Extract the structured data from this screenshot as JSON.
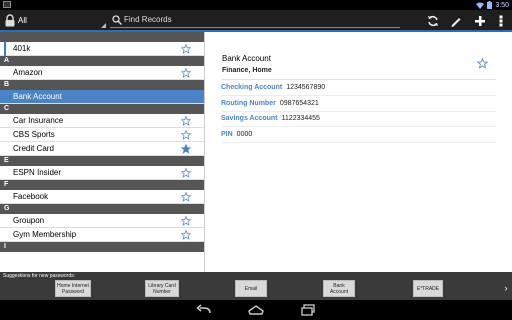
{
  "status": {
    "time": "3:50"
  },
  "actionbar": {
    "category": "All",
    "search_placeholder": "Find Records"
  },
  "sections": [
    {
      "letter": "",
      "rows": [
        {
          "label": "401k",
          "starred": false
        }
      ]
    },
    {
      "letter": "A",
      "rows": [
        {
          "label": "Amazon",
          "starred": false
        }
      ]
    },
    {
      "letter": "B",
      "rows": [
        {
          "label": "Bank Account",
          "starred": false,
          "selected": true
        }
      ]
    },
    {
      "letter": "C",
      "rows": [
        {
          "label": "Car Insurance",
          "starred": false
        },
        {
          "label": "CBS Sports",
          "starred": false
        },
        {
          "label": "Credit Card",
          "starred": true
        }
      ]
    },
    {
      "letter": "E",
      "rows": [
        {
          "label": "ESPN Insider",
          "starred": false
        }
      ]
    },
    {
      "letter": "F",
      "rows": [
        {
          "label": "Facebook",
          "starred": false
        }
      ]
    },
    {
      "letter": "G",
      "rows": [
        {
          "label": "Groupon",
          "starred": false
        },
        {
          "label": "Gym Membership",
          "starred": false
        }
      ]
    },
    {
      "letter": "I",
      "rows": []
    }
  ],
  "detail": {
    "title": "Bank Account",
    "subtitle": "Finance, Home",
    "fields": [
      {
        "key": "Checking Account",
        "value": "1234567890"
      },
      {
        "key": "Routing Number",
        "value": "0987654321"
      },
      {
        "key": "Savings Account",
        "value": "1122334455"
      },
      {
        "key": "PIN",
        "value": "0000"
      }
    ]
  },
  "suggestions": {
    "header": "Suggestions for new passwords:",
    "chips": [
      "Home Internet Password",
      "Library Card Number",
      "Email",
      "Bank Account",
      "E*TRADE"
    ]
  },
  "colors": {
    "accent": "#4a84c7",
    "section": "#555555",
    "actionbar": "#1f1f1f"
  }
}
